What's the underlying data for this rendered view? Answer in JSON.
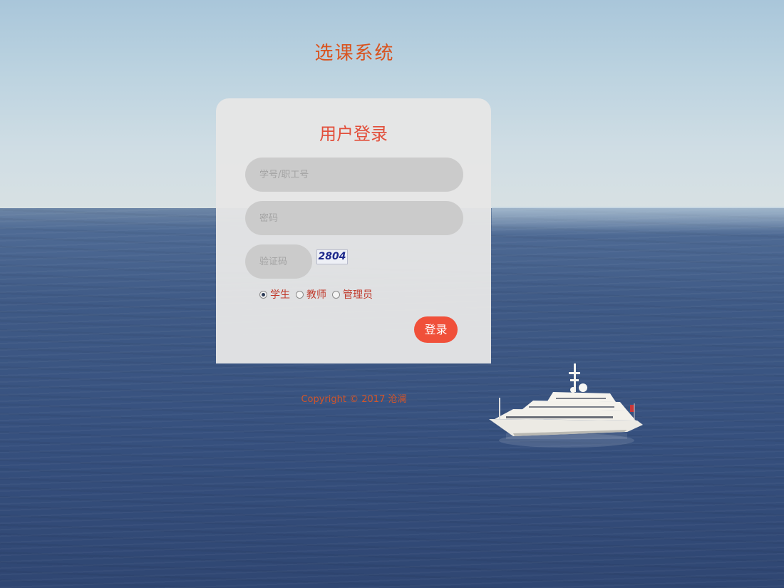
{
  "header": {
    "site_title": "选课系统"
  },
  "login": {
    "title": "用户登录",
    "username_placeholder": "学号/职工号",
    "password_placeholder": "密码",
    "captcha_placeholder": "验证码",
    "captcha_text": "2804",
    "roles": [
      {
        "label": "学生",
        "checked": true
      },
      {
        "label": "教师",
        "checked": false
      },
      {
        "label": "管理员",
        "checked": false
      }
    ],
    "submit_label": "登录"
  },
  "footer": {
    "copyright": "Copyright © 2017 沧澜"
  },
  "colors": {
    "accent": "#f0503a",
    "title": "#d9531e",
    "field_bg": "#cbcbcb",
    "panel_bg": "#e6e6e6"
  }
}
